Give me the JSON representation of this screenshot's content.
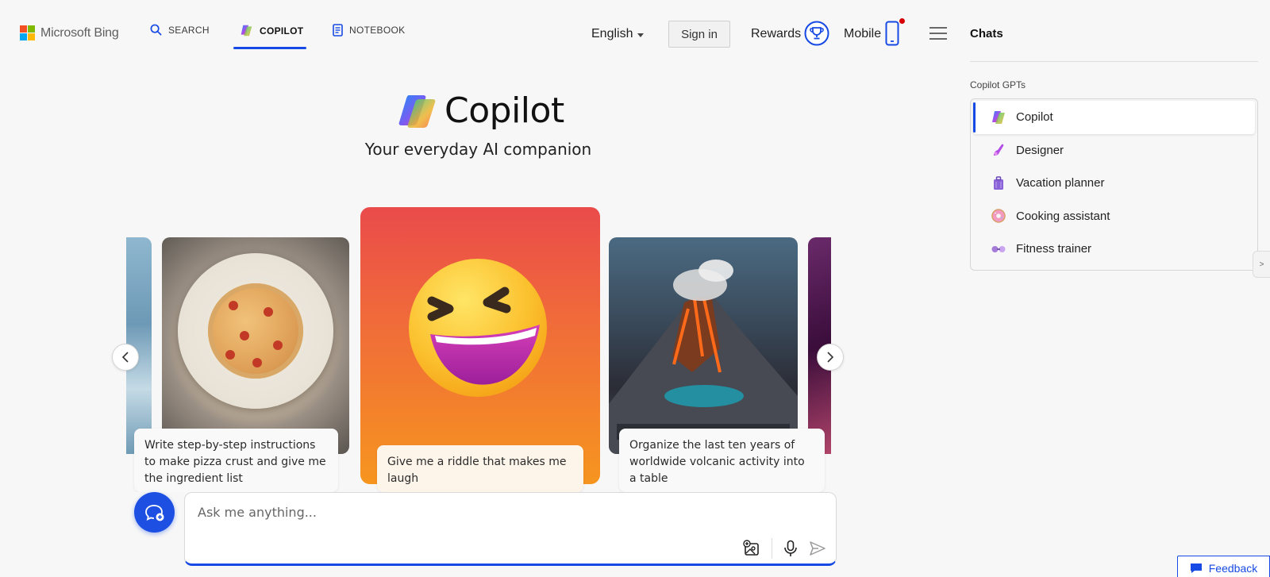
{
  "header": {
    "logo_text": "Microsoft Bing",
    "nav": {
      "search": "SEARCH",
      "copilot": "COPILOT",
      "notebook": "NOTEBOOK"
    },
    "language": "English",
    "sign_in": "Sign in",
    "rewards": "Rewards",
    "mobile": "Mobile"
  },
  "hero": {
    "title": "Copilot",
    "subtitle": "Your everyday AI companion"
  },
  "carousel": {
    "cards": [
      {
        "caption": "Write step-by-step instructions to make pizza crust and give me the ingredient list"
      },
      {
        "caption": "Give me a riddle that makes me laugh"
      },
      {
        "caption": "Organize the last ten years of worldwide volcanic activity into a table"
      }
    ]
  },
  "chat_input": {
    "placeholder": "Ask me anything..."
  },
  "sidebar": {
    "title": "Chats",
    "gpts_label": "Copilot GPTs",
    "gpts": [
      {
        "label": "Copilot",
        "icon": "copilot-icon"
      },
      {
        "label": "Designer",
        "icon": "designer-icon"
      },
      {
        "label": "Vacation planner",
        "icon": "suitcase-icon"
      },
      {
        "label": "Cooking assistant",
        "icon": "donut-icon"
      },
      {
        "label": "Fitness trainer",
        "icon": "dumbbell-icon"
      }
    ]
  },
  "feedback": "Feedback",
  "colors": {
    "accent": "#174ae4",
    "background": "#f7f7f7"
  }
}
